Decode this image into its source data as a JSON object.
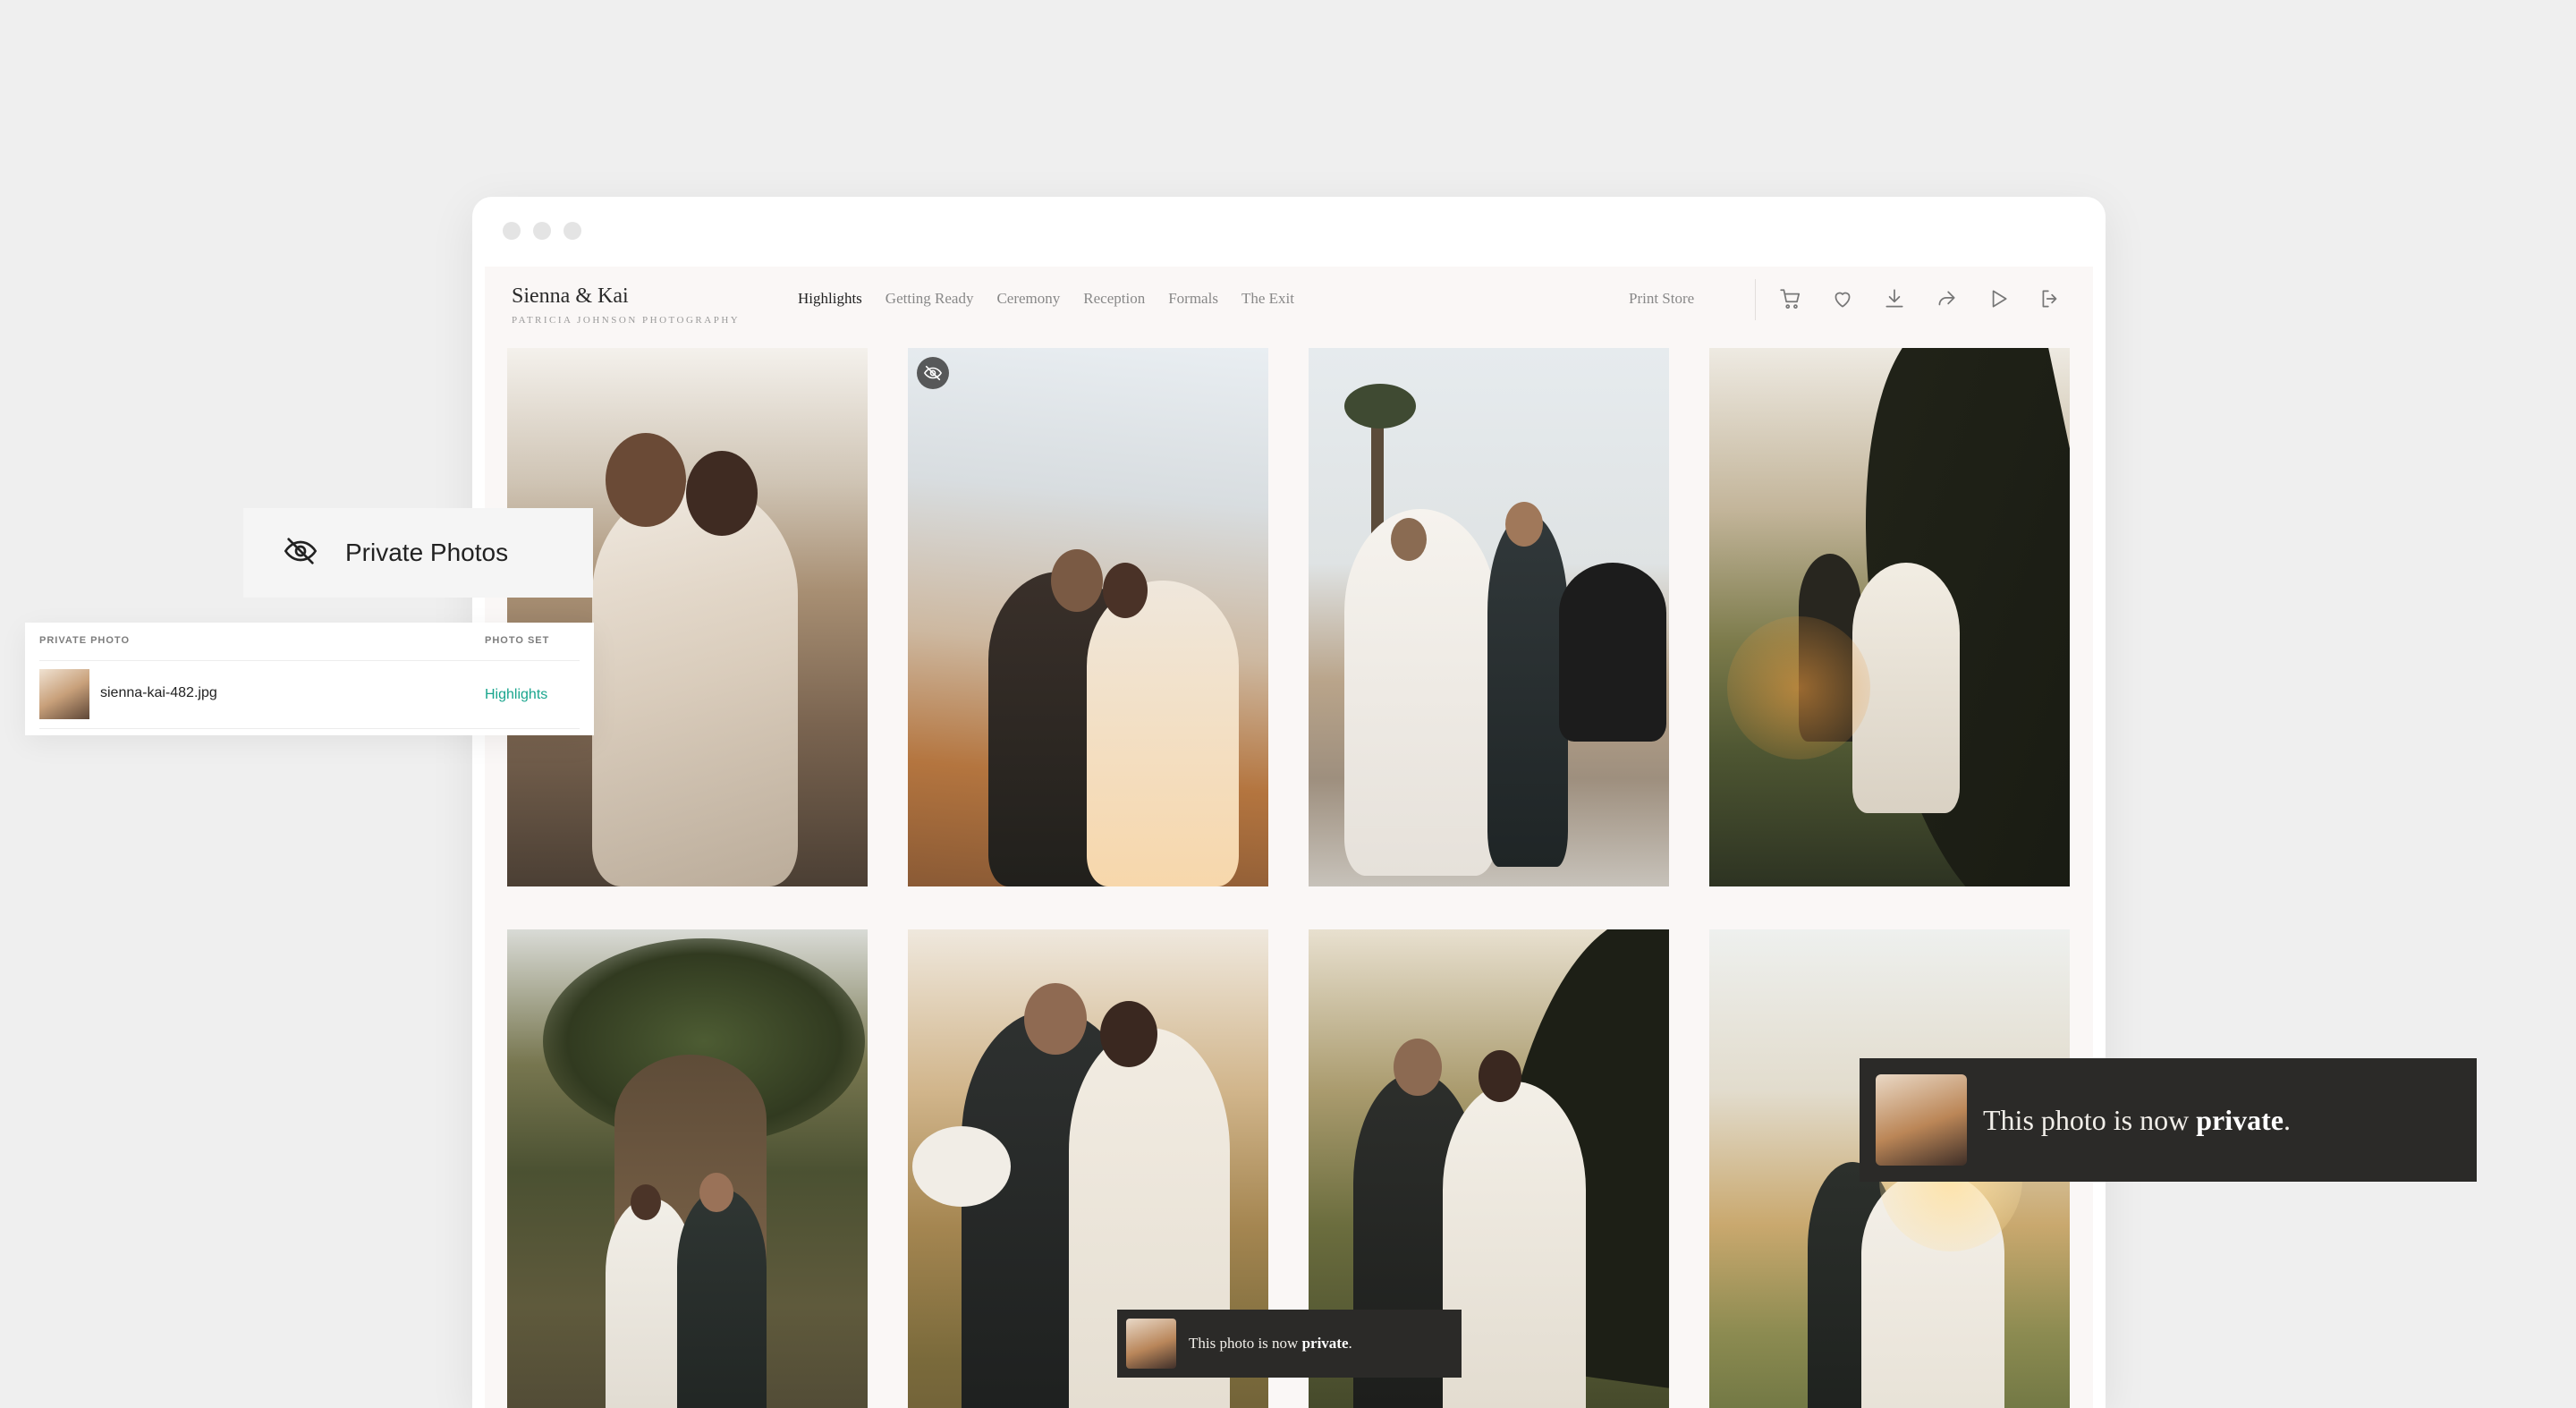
{
  "gallery": {
    "title": "Sienna & Kai",
    "subtitle": "PATRICIA JOHNSON PHOTOGRAPHY"
  },
  "nav": {
    "items": [
      "Highlights",
      "Getting Ready",
      "Ceremony",
      "Reception",
      "Formals",
      "The Exit"
    ],
    "active": "Highlights",
    "print_store": "Print Store"
  },
  "toolbar_icons": [
    "cart-icon",
    "heart-icon",
    "download-icon",
    "share-icon",
    "play-icon",
    "logout-icon"
  ],
  "private_card": {
    "label": "Private Photos",
    "icon": "eye-off-icon"
  },
  "private_table": {
    "headers": [
      "PRIVATE PHOTO",
      "PHOTO SET"
    ],
    "rows": [
      {
        "file": "sienna-kai-482.jpg",
        "set": "Highlights"
      }
    ]
  },
  "toast": {
    "prefix": "This photo is now ",
    "emphasis": "private",
    "suffix": "."
  },
  "colors": {
    "accent": "#19a58d",
    "toast_bg": "#2b2a28",
    "page_bg": "#efefef"
  }
}
